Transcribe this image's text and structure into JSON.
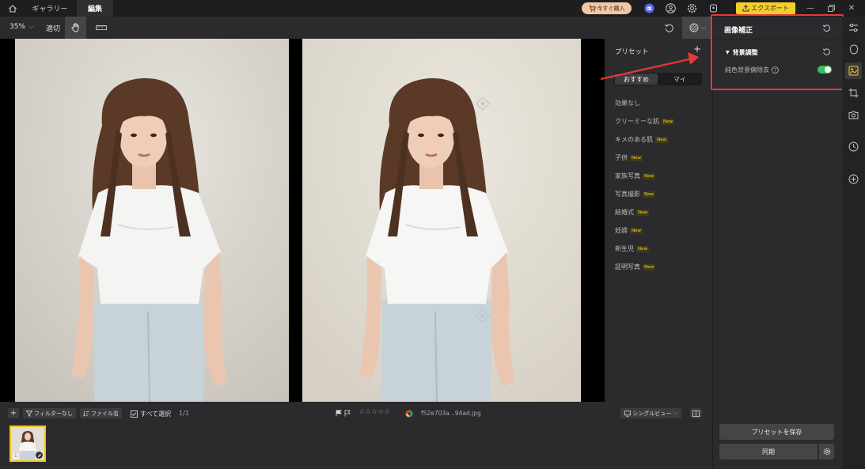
{
  "titlebar": {
    "tab_gallery": "ギャラリー",
    "tab_edit": "編集",
    "buy_label": "今すぐ購入",
    "export_label": "エクスポート"
  },
  "toolbar": {
    "zoom": "35%",
    "fit": "適切"
  },
  "presets": {
    "title": "プリセット",
    "seg_recommended": "おすすめ",
    "seg_mine": "マイ",
    "new_badge": "New",
    "items": [
      {
        "label": "効果なし",
        "new": false
      },
      {
        "label": "クリーミーな肌",
        "new": true
      },
      {
        "label": "キメのある肌",
        "new": true
      },
      {
        "label": "子供",
        "new": true
      },
      {
        "label": "家族写真",
        "new": true
      },
      {
        "label": "写真撮影",
        "new": true
      },
      {
        "label": "結婚式",
        "new": true
      },
      {
        "label": "妊婦",
        "new": true
      },
      {
        "label": "新生児",
        "new": true
      },
      {
        "label": "証明写真",
        "new": true
      }
    ]
  },
  "bottombar": {
    "filter": "フィルターなし",
    "filename_sort": "ファイル名",
    "select_all": "すべて選択",
    "count": "1/1",
    "stars": "☆☆☆☆☆",
    "filename": "f52e703a...94ad.jpg",
    "view_mode": "シングルビュー"
  },
  "filmstrip": {
    "thumb_index": "1"
  },
  "rpanel": {
    "title": "画像補正",
    "section": "背景調整",
    "row_label": "純色背景偏除去",
    "toggle_on": true,
    "save_preset": "プリセットを保存",
    "sync": "同期"
  },
  "colors": {
    "accent_yellow": "#f3cf2a",
    "toggle_green": "#35c25a",
    "highlight_red": "#e53935",
    "buy_peach": "#f3c7a4"
  },
  "icons": {
    "titlebar": [
      "home-icon",
      "cart-icon",
      "discord-icon",
      "user-icon",
      "gear-icon",
      "shirt-icon",
      "export-icon",
      "minimize-icon",
      "restore-icon",
      "close-icon"
    ],
    "rail": [
      "sliders-icon",
      "face-icon",
      "image-adjust-icon",
      "crop-icon",
      "camera-icon",
      "history-icon",
      "add-icon"
    ]
  }
}
